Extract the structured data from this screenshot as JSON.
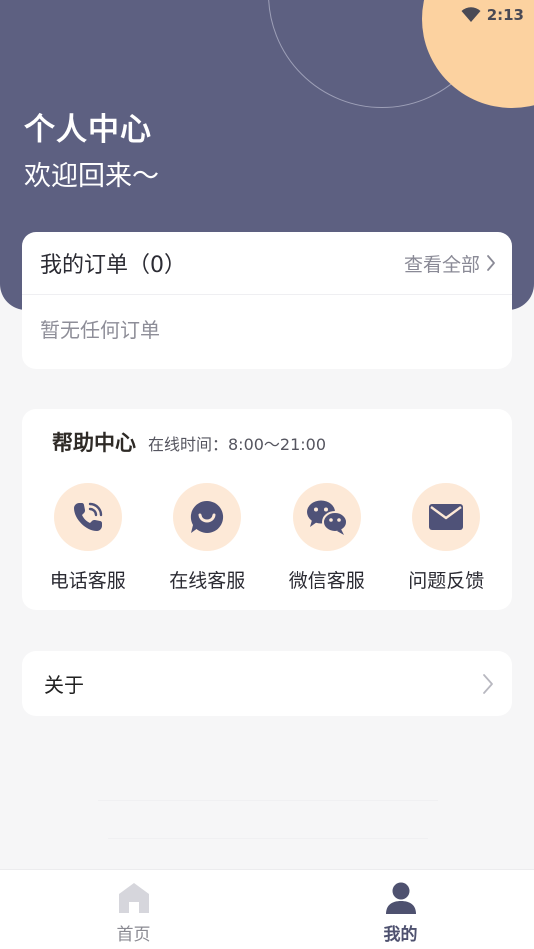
{
  "status_bar": {
    "time": "2:13",
    "wifi_icon": "wifi-icon"
  },
  "header": {
    "title": "个人中心",
    "subtitle": "欢迎回来～"
  },
  "orders": {
    "title": "我的订单（0）",
    "view_all": "查看全部",
    "empty_text": "暂无任何订单"
  },
  "help_center": {
    "title": "帮助中心",
    "hours": "在线时间：8:00～21:00",
    "items": [
      {
        "label": "电话客服",
        "icon": "phone-icon"
      },
      {
        "label": "在线客服",
        "icon": "chat-bubble-icon"
      },
      {
        "label": "微信客服",
        "icon": "wechat-icon"
      },
      {
        "label": "问题反馈",
        "icon": "envelope-icon"
      }
    ]
  },
  "about": {
    "label": "关于"
  },
  "tabbar": {
    "tabs": [
      {
        "label": "首页",
        "icon": "home-icon",
        "active": false
      },
      {
        "label": "我的",
        "icon": "user-icon",
        "active": true
      }
    ]
  },
  "colors": {
    "header_bg": "#5d6081",
    "accent_orange": "#fcd2a0",
    "icon_bg": "#fde9d7",
    "icon_color": "#4f5278"
  }
}
